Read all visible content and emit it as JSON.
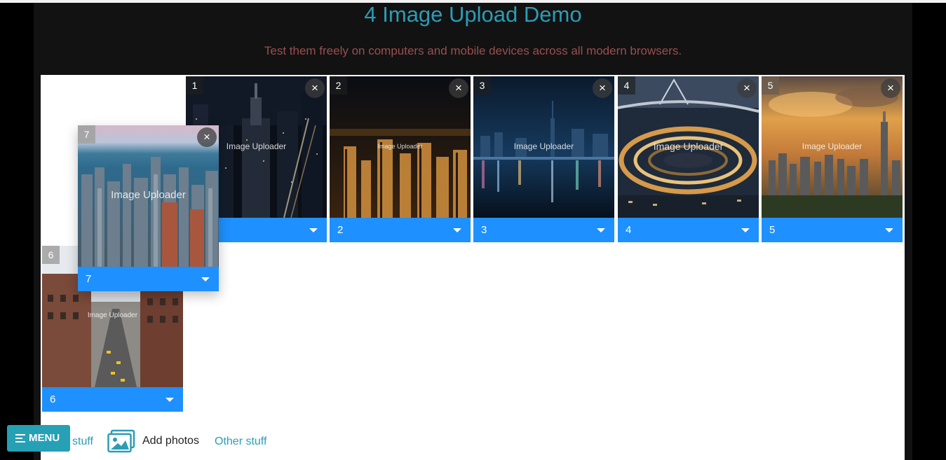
{
  "header": {
    "title": "4 Image Upload Demo",
    "subtitle": "Test them freely on computers and mobile devices across all modern browsers."
  },
  "uploader": {
    "watermark": "Image Uploader",
    "tiles": [
      {
        "index": "1",
        "select_value": "1",
        "scene": "night-skyscrapers"
      },
      {
        "index": "2",
        "select_value": "2",
        "scene": "night-city-lights"
      },
      {
        "index": "3",
        "select_value": "3",
        "scene": "waterfront-skyline"
      },
      {
        "index": "4",
        "select_value": "4",
        "scene": "bridge-interchange"
      },
      {
        "index": "5",
        "select_value": "5",
        "scene": "sunset-harbour"
      },
      {
        "index": "6",
        "select_value": "6",
        "scene": "city-street"
      },
      {
        "index": "7",
        "select_value": "7",
        "scene": "daytime-skyline",
        "state": "dragging"
      }
    ],
    "close_glyph": "×"
  },
  "footer": {
    "left_link": "stuff",
    "add_photos_label": "Add photos",
    "right_link": "Other stuff"
  },
  "menu": {
    "label": "MENU"
  },
  "colors": {
    "accent": "#2a9db6",
    "tile_bar": "#1e90ff",
    "subtitle": "#9a4e4e",
    "panel": "#ffffff",
    "page_bg": "#121212"
  },
  "icons": [
    "close-icon",
    "chevron-down-icon",
    "photos-icon",
    "hamburger-icon"
  ]
}
